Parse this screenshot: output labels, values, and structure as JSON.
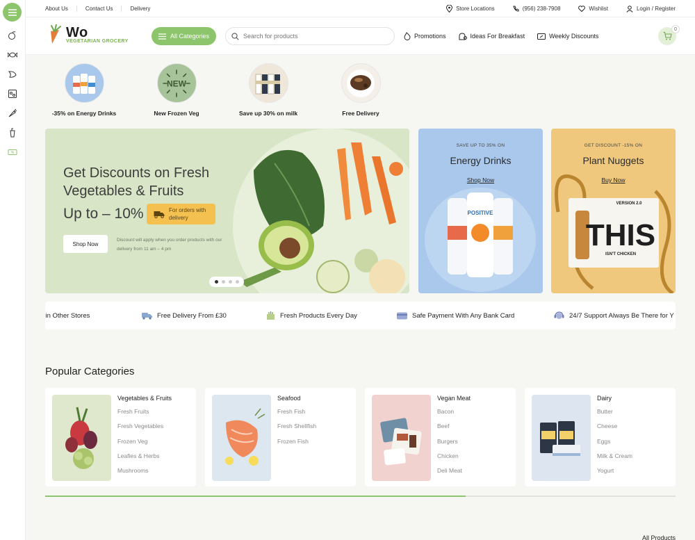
{
  "topbar": {
    "links": [
      "About Us",
      "Contact Us",
      "Delivery"
    ],
    "store_locations": "Store Locations",
    "phone": "(956) 238-7908",
    "wishlist": "Wishlist",
    "login": "Login / Register"
  },
  "header": {
    "logo_title": "Wo",
    "logo_subtitle": "VEGETARIAN GROCERY",
    "all_categories": "All Categories",
    "search_placeholder": "Search for products",
    "nav": [
      "Promotions",
      "Ideas For Breakfast",
      "Weekly Discounts"
    ],
    "cart_count": "0"
  },
  "stories": [
    {
      "label": "-35% on Energy Drinks"
    },
    {
      "label": "New Frozen Veg",
      "badge": "NEW"
    },
    {
      "label": "Save up 30% on milk"
    },
    {
      "label": "Free Delivery"
    }
  ],
  "hero": {
    "title": "Get Discounts on Fresh Vegetables & Fruits",
    "discount": "Up to – 10%",
    "tag": "For orders with delivery",
    "shop_now": "Shop Now",
    "note": "Discount will apply when you order products with our delivery from 11 am – 4 pm"
  },
  "promos": [
    {
      "small": "SAVE UP TO 35% ON",
      "title": "Energy Drinks",
      "link": "Shop Now",
      "product_text": "POSITIVE",
      "bg": "#a9c8ec"
    },
    {
      "small": "GET DISCOUNT -15% ON",
      "title": "Plant Nuggets",
      "link": "Buy Now",
      "product_text": "THIS",
      "product_sub": "ISN'T CHICKEN",
      "product_version": "VERSION 2.0",
      "bg": "#efc77d"
    }
  ],
  "features": [
    "han in Other Stores",
    "Free Delivery From £30",
    "Fresh Products Every Day",
    "Safe Payment With Any Bank Card",
    "24/7 Support Always Be There for Y"
  ],
  "popular": {
    "title": "Popular Categories",
    "cards": [
      {
        "title": "Vegetables & Fruits",
        "items": [
          "Fresh Fruits",
          "Fresh Vegetables",
          "Frozen Veg",
          "Leafies & Herbs",
          "Mushrooms"
        ],
        "bg": "#dfe8cc"
      },
      {
        "title": "Seafood",
        "items": [
          "Fresh Fish",
          "Fresh Shellfish",
          "Frozen Fish"
        ],
        "bg": "#dce7f0"
      },
      {
        "title": "Vegan Meat",
        "items": [
          "Bacon",
          "Beef",
          "Burgers",
          "Chicken",
          "Deli Meat"
        ],
        "bg": "#f1d2cf"
      },
      {
        "title": "Dairy",
        "items": [
          "Butter",
          "Cheese",
          "Eggs",
          "Milk & Cream",
          "Yogurt"
        ],
        "bg": "#dde5f1"
      }
    ],
    "scroll_progress": 0.667
  },
  "all_products": "All Products",
  "colors": {
    "brand_green": "#8cc56b",
    "accent_yellow": "#f4c150"
  }
}
